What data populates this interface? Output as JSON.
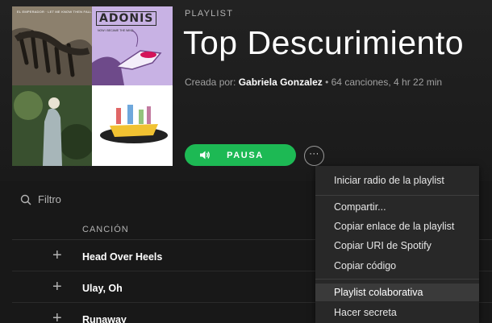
{
  "playlist": {
    "type_label": "PLAYLIST",
    "title": "Top Descurimiento",
    "created_by_label": "Creada por:",
    "owner": "Gabriela Gonzalez",
    "stats": " • 64 canciones, 4 hr 22 min"
  },
  "cover": {
    "tile1_text": "EL EMPERADOR · LET ME KNOW THEN FALL",
    "tile2_title": "ADONIS",
    "tile2_sub": "NOW I BECAME THE WIND"
  },
  "controls": {
    "pause_label": "PAUSA",
    "more_label": "···",
    "accent": "#1db954"
  },
  "filter": {
    "label": "Filtro"
  },
  "table": {
    "column_song": "CANCIÓN",
    "tracks": [
      {
        "add": "+",
        "name": "Head Over Heels"
      },
      {
        "add": "+",
        "name": "Ulay, Oh"
      },
      {
        "add": "+",
        "name": "Runaway"
      }
    ]
  },
  "context_menu": {
    "items": [
      "Iniciar radio de la playlist",
      "Compartir...",
      "Copiar enlace de la playlist",
      "Copiar URI de Spotify",
      "Copiar código",
      "Playlist colaborativa",
      "Hacer secreta"
    ],
    "highlighted_index": 5
  }
}
